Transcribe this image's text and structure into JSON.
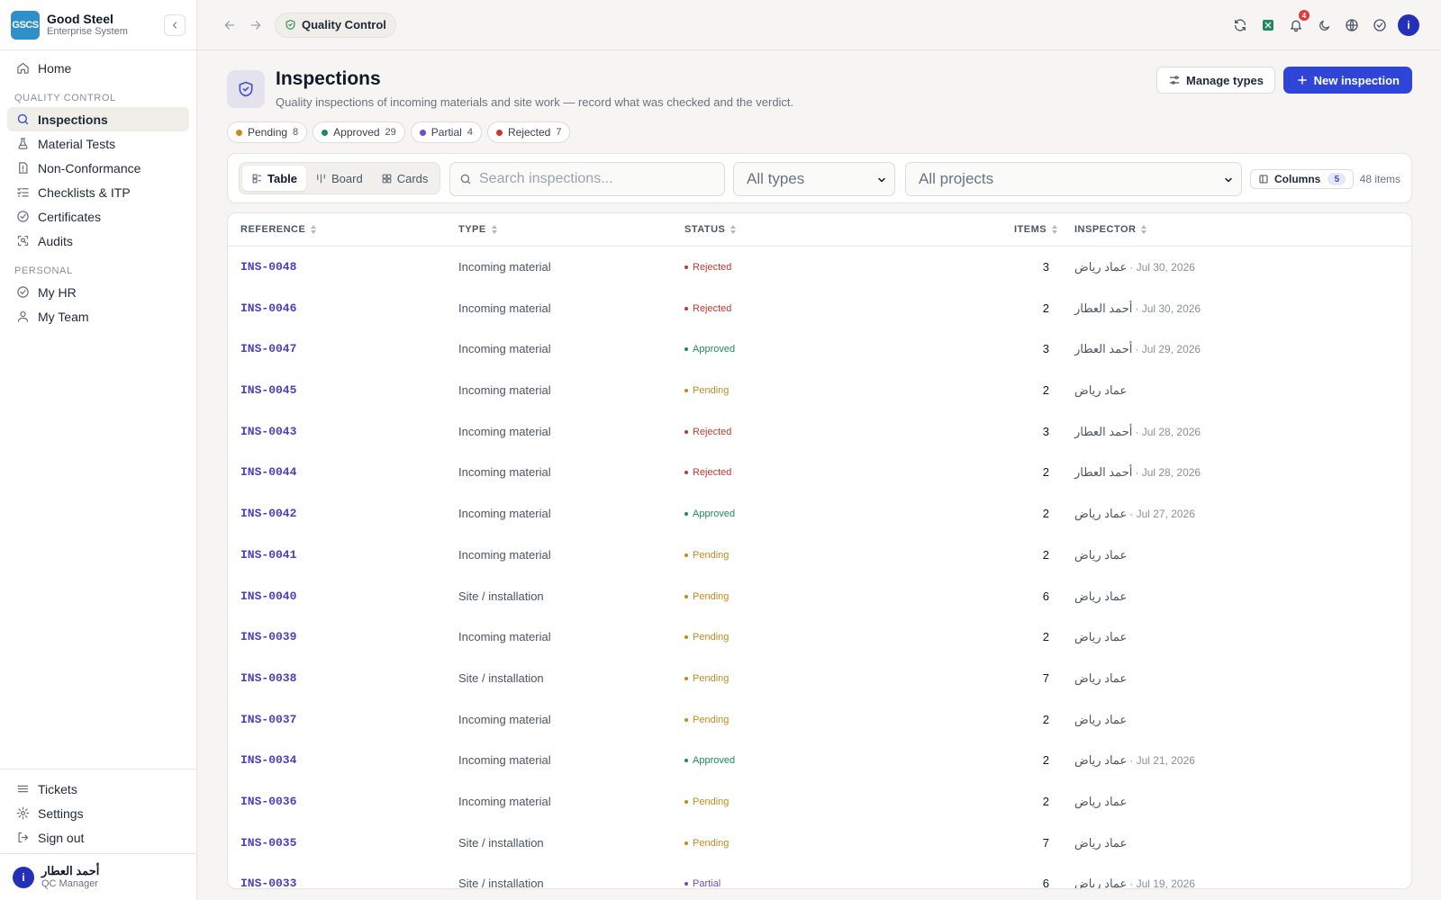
{
  "brand": {
    "logo_text": "GSCS",
    "name": "Good Steel",
    "subtitle": "Enterprise System"
  },
  "sidebar": {
    "items_top": [
      {
        "label": "Home",
        "icon": "home-icon"
      }
    ],
    "sections": [
      {
        "title": "QUALITY CONTROL",
        "items": [
          {
            "label": "Inspections",
            "icon": "search-icon",
            "active": true
          },
          {
            "label": "Material Tests",
            "icon": "flask-icon"
          },
          {
            "label": "Non-Conformance",
            "icon": "alert-icon"
          },
          {
            "label": "Checklists & ITP",
            "icon": "checklist-icon"
          },
          {
            "label": "Certificates",
            "icon": "check-circle-icon"
          },
          {
            "label": "Audits",
            "icon": "scan-icon"
          }
        ]
      },
      {
        "title": "PERSONAL",
        "items": [
          {
            "label": "My HR",
            "icon": "check-circle-icon"
          },
          {
            "label": "My Team",
            "icon": "user-icon"
          }
        ]
      }
    ],
    "bottom_items": [
      {
        "label": "Tickets",
        "icon": "ticket-icon"
      },
      {
        "label": "Settings",
        "icon": "gear-icon"
      },
      {
        "label": "Sign out",
        "icon": "sign-out-icon"
      }
    ],
    "user": {
      "avatar": "i",
      "name": "أحمد العطار",
      "role": "QC Manager"
    }
  },
  "topbar": {
    "breadcrumb": "Quality Control",
    "notification_count": "4",
    "avatar": "i"
  },
  "header": {
    "title": "Inspections",
    "subtitle": "Quality inspections of incoming materials and site work — record what was checked and the verdict.",
    "manage_types_label": "Manage types",
    "new_inspection_label": "New inspection"
  },
  "status_chips": [
    {
      "label": "Pending",
      "count": "8",
      "color": "#c58a1a"
    },
    {
      "label": "Approved",
      "count": "29",
      "color": "#1f8a5a"
    },
    {
      "label": "Partial",
      "count": "4",
      "color": "#6a4fd1"
    },
    {
      "label": "Rejected",
      "count": "7",
      "color": "#c23a2e"
    }
  ],
  "toolbar": {
    "views": [
      "Table",
      "Board",
      "Cards"
    ],
    "active_view": "Table",
    "search_placeholder": "Search inspections...",
    "type_filter": "All types",
    "project_filter": "All projects",
    "columns_label": "Columns",
    "columns_count": "5",
    "items_count": "48 items"
  },
  "table": {
    "columns": [
      "REFERENCE",
      "TYPE",
      "STATUS",
      "ITEMS",
      "INSPECTOR"
    ],
    "rows": [
      {
        "ref": "INS-0048",
        "type": "Incoming material",
        "status": "Rejected",
        "items": "3",
        "inspector": "عماد رياض",
        "date": "Jul 30, 2026"
      },
      {
        "ref": "INS-0046",
        "type": "Incoming material",
        "status": "Rejected",
        "items": "2",
        "inspector": "أحمد العطار",
        "date": "Jul 30, 2026"
      },
      {
        "ref": "INS-0047",
        "type": "Incoming material",
        "status": "Approved",
        "items": "3",
        "inspector": "أحمد العطار",
        "date": "Jul 29, 2026"
      },
      {
        "ref": "INS-0045",
        "type": "Incoming material",
        "status": "Pending",
        "items": "2",
        "inspector": "عماد رياض",
        "date": ""
      },
      {
        "ref": "INS-0043",
        "type": "Incoming material",
        "status": "Rejected",
        "items": "3",
        "inspector": "أحمد العطار",
        "date": "Jul 28, 2026"
      },
      {
        "ref": "INS-0044",
        "type": "Incoming material",
        "status": "Rejected",
        "items": "2",
        "inspector": "أحمد العطار",
        "date": "Jul 28, 2026"
      },
      {
        "ref": "INS-0042",
        "type": "Incoming material",
        "status": "Approved",
        "items": "2",
        "inspector": "عماد رياض",
        "date": "Jul 27, 2026"
      },
      {
        "ref": "INS-0041",
        "type": "Incoming material",
        "status": "Pending",
        "items": "2",
        "inspector": "عماد رياض",
        "date": ""
      },
      {
        "ref": "INS-0040",
        "type": "Site / installation",
        "status": "Pending",
        "items": "6",
        "inspector": "عماد رياض",
        "date": ""
      },
      {
        "ref": "INS-0039",
        "type": "Incoming material",
        "status": "Pending",
        "items": "2",
        "inspector": "عماد رياض",
        "date": ""
      },
      {
        "ref": "INS-0038",
        "type": "Site / installation",
        "status": "Pending",
        "items": "7",
        "inspector": "عماد رياض",
        "date": ""
      },
      {
        "ref": "INS-0037",
        "type": "Incoming material",
        "status": "Pending",
        "items": "2",
        "inspector": "عماد رياض",
        "date": ""
      },
      {
        "ref": "INS-0034",
        "type": "Incoming material",
        "status": "Approved",
        "items": "2",
        "inspector": "عماد رياض",
        "date": "Jul 21, 2026"
      },
      {
        "ref": "INS-0036",
        "type": "Incoming material",
        "status": "Pending",
        "items": "2",
        "inspector": "عماد رياض",
        "date": ""
      },
      {
        "ref": "INS-0035",
        "type": "Site / installation",
        "status": "Pending",
        "items": "7",
        "inspector": "عماد رياض",
        "date": ""
      },
      {
        "ref": "INS-0033",
        "type": "Site / installation",
        "status": "Partial",
        "items": "6",
        "inspector": "عماد رياض",
        "date": "Jul 19, 2026"
      }
    ]
  },
  "status_colors": {
    "Rejected": "#c23a2e",
    "Approved": "#1f8a5a",
    "Pending": "#c58a1a",
    "Partial": "#6a4fd1"
  }
}
